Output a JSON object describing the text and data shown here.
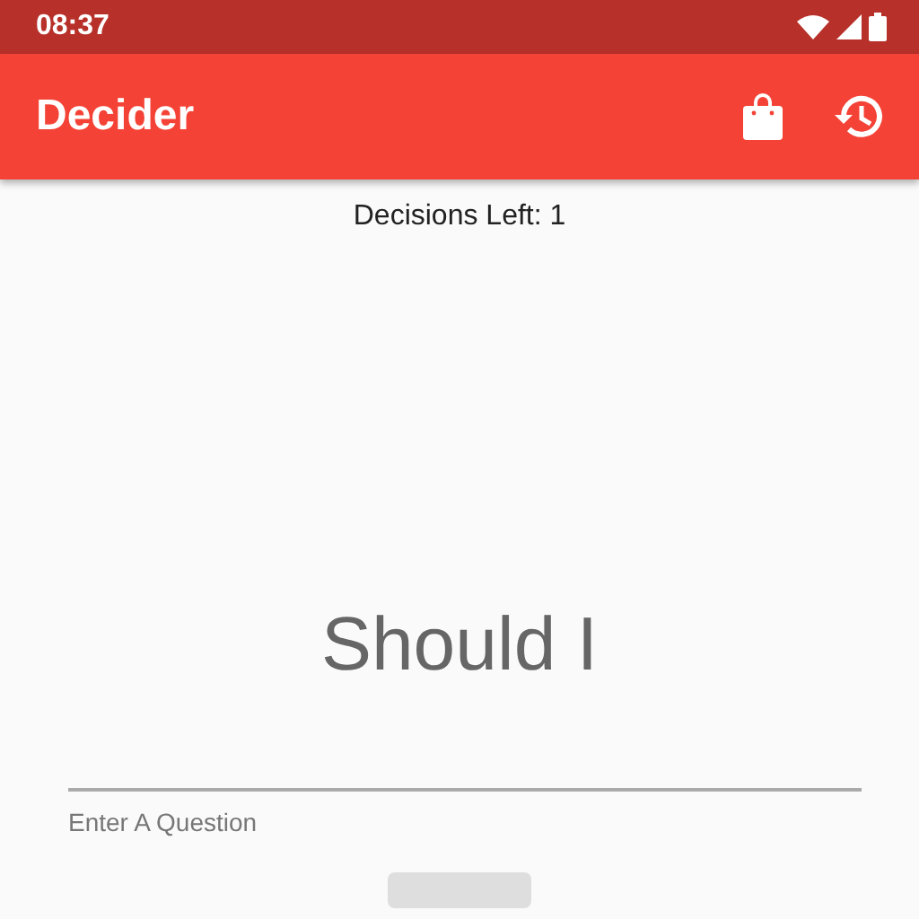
{
  "status_bar": {
    "time": "08:37"
  },
  "app_bar": {
    "title": "Decider"
  },
  "decisions_left": "Decisions Left: 1",
  "prompt": "Should I",
  "question_field": {
    "helper_text": "Enter A Question"
  },
  "submit_button": {
    "kind": "button"
  }
}
